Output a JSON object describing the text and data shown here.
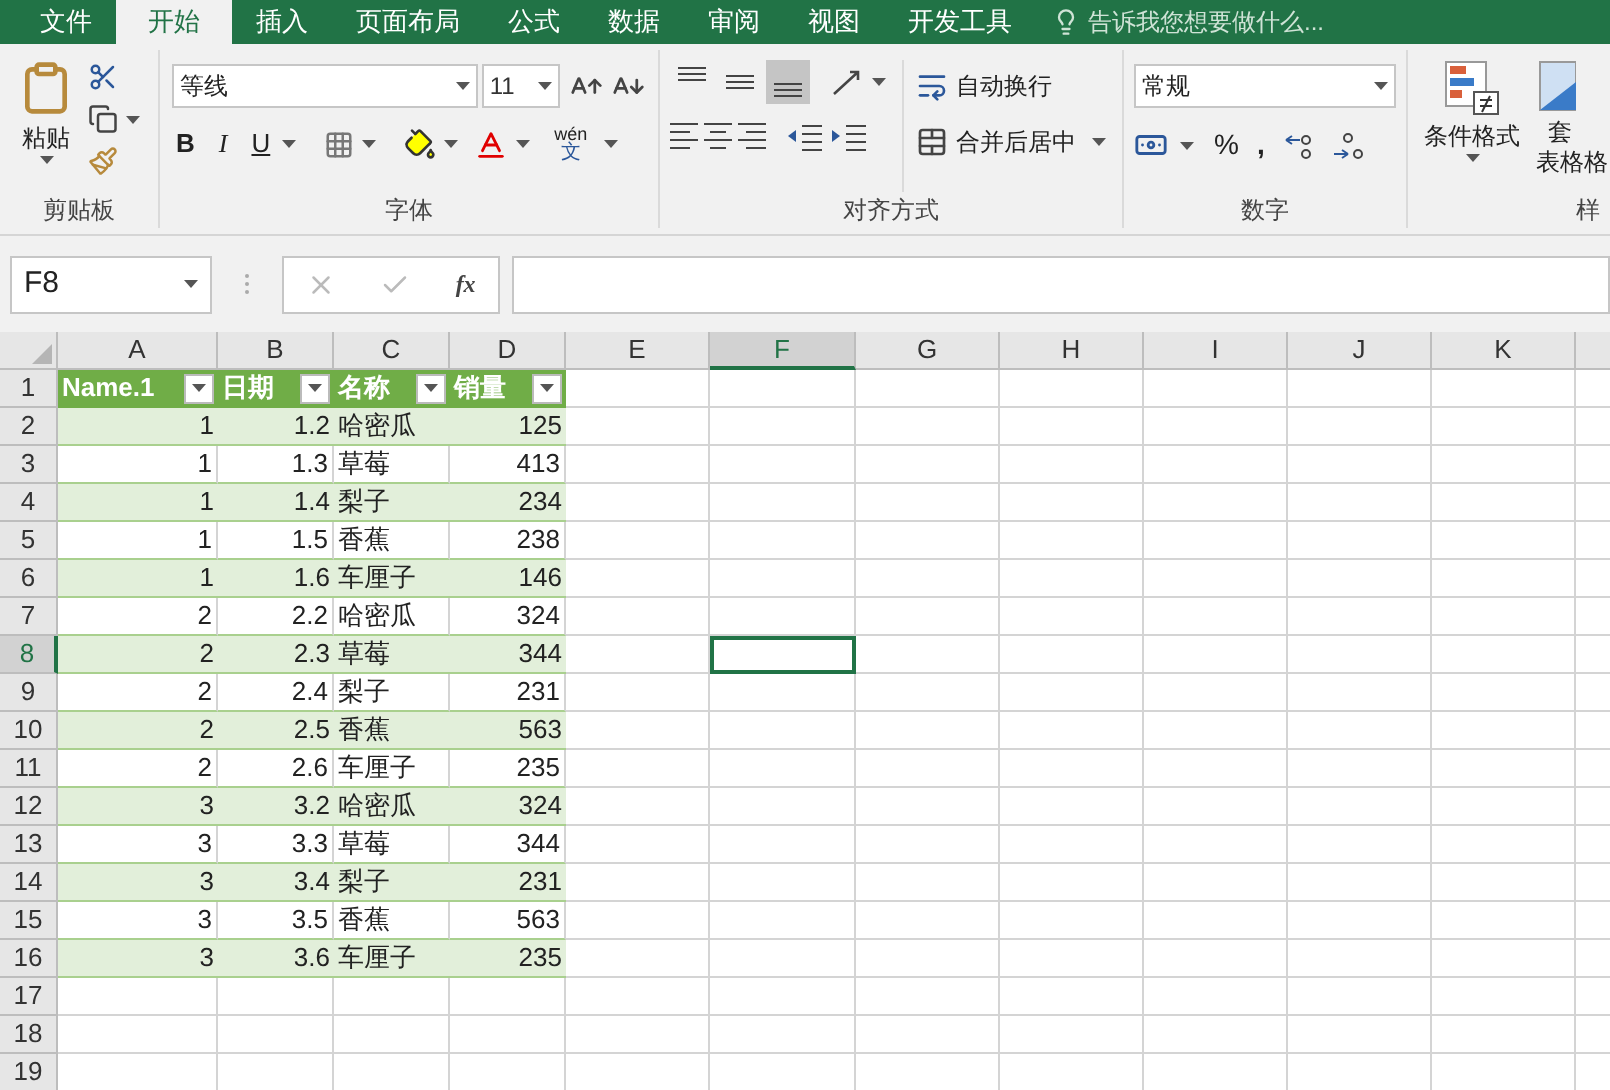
{
  "tabs": [
    {
      "label": "文件",
      "selected": false
    },
    {
      "label": "开始",
      "selected": true
    },
    {
      "label": "插入",
      "selected": false
    },
    {
      "label": "页面布局",
      "selected": false
    },
    {
      "label": "公式",
      "selected": false
    },
    {
      "label": "数据",
      "selected": false
    },
    {
      "label": "审阅",
      "selected": false
    },
    {
      "label": "视图",
      "selected": false
    },
    {
      "label": "开发工具",
      "selected": false
    }
  ],
  "tell_me": "告诉我您想要做什么...",
  "ribbon": {
    "clipboard": {
      "paste": "粘贴",
      "label": "剪贴板"
    },
    "font": {
      "name": "等线",
      "size": "11",
      "bold": "B",
      "italic": "I",
      "underline": "U",
      "phonetic_top": "wén",
      "phonetic_bottom": "文",
      "label": "字体"
    },
    "alignment": {
      "vertical_align": [
        {
          "selected": false
        },
        {
          "selected": false
        },
        {
          "selected": true
        }
      ],
      "wrap": "自动换行",
      "merge": "合并后居中",
      "label": "对齐方式"
    },
    "number": {
      "format": "常规",
      "percent": "%",
      "comma": ",",
      "label": "数字"
    },
    "styles": {
      "conditional": "条件格式",
      "table_top": "套",
      "table_bottom": "表格格",
      "label": "样"
    }
  },
  "name_box": "F8",
  "fx": "fx",
  "columns": [
    {
      "label": "A",
      "selected": false
    },
    {
      "label": "B",
      "selected": false
    },
    {
      "label": "C",
      "selected": false
    },
    {
      "label": "D",
      "selected": false
    },
    {
      "label": "E",
      "selected": false
    },
    {
      "label": "F",
      "selected": true
    },
    {
      "label": "G",
      "selected": false
    },
    {
      "label": "H",
      "selected": false
    },
    {
      "label": "I",
      "selected": false
    },
    {
      "label": "J",
      "selected": false
    },
    {
      "label": "K",
      "selected": false
    }
  ],
  "rows": [
    {
      "label": "1",
      "selected": false
    },
    {
      "label": "2",
      "selected": false
    },
    {
      "label": "3",
      "selected": false
    },
    {
      "label": "4",
      "selected": false
    },
    {
      "label": "5",
      "selected": false
    },
    {
      "label": "6",
      "selected": false
    },
    {
      "label": "7",
      "selected": false
    },
    {
      "label": "8",
      "selected": true
    },
    {
      "label": "9",
      "selected": false
    },
    {
      "label": "10",
      "selected": false
    },
    {
      "label": "11",
      "selected": false
    },
    {
      "label": "12",
      "selected": false
    },
    {
      "label": "13",
      "selected": false
    },
    {
      "label": "14",
      "selected": false
    },
    {
      "label": "15",
      "selected": false
    },
    {
      "label": "16",
      "selected": false
    },
    {
      "label": "17",
      "selected": false
    },
    {
      "label": "18",
      "selected": false
    },
    {
      "label": "19",
      "selected": false
    }
  ],
  "table": {
    "headers": [
      "Name.1",
      "日期",
      "名称",
      "销量"
    ],
    "records": [
      [
        "1",
        "1.2",
        "哈密瓜",
        "125"
      ],
      [
        "1",
        "1.3",
        "草莓",
        "413"
      ],
      [
        "1",
        "1.4",
        "梨子",
        "234"
      ],
      [
        "1",
        "1.5",
        "香蕉",
        "238"
      ],
      [
        "1",
        "1.6",
        "车厘子",
        "146"
      ],
      [
        "2",
        "2.2",
        "哈密瓜",
        "324"
      ],
      [
        "2",
        "2.3",
        "草莓",
        "344"
      ],
      [
        "2",
        "2.4",
        "梨子",
        "231"
      ],
      [
        "2",
        "2.5",
        "香蕉",
        "563"
      ],
      [
        "2",
        "2.6",
        "车厘子",
        "235"
      ],
      [
        "3",
        "3.2",
        "哈密瓜",
        "324"
      ],
      [
        "3",
        "3.3",
        "草莓",
        "344"
      ],
      [
        "3",
        "3.4",
        "梨子",
        "231"
      ],
      [
        "3",
        "3.5",
        "香蕉",
        "563"
      ],
      [
        "3",
        "3.6",
        "车厘子",
        "235"
      ]
    ]
  }
}
